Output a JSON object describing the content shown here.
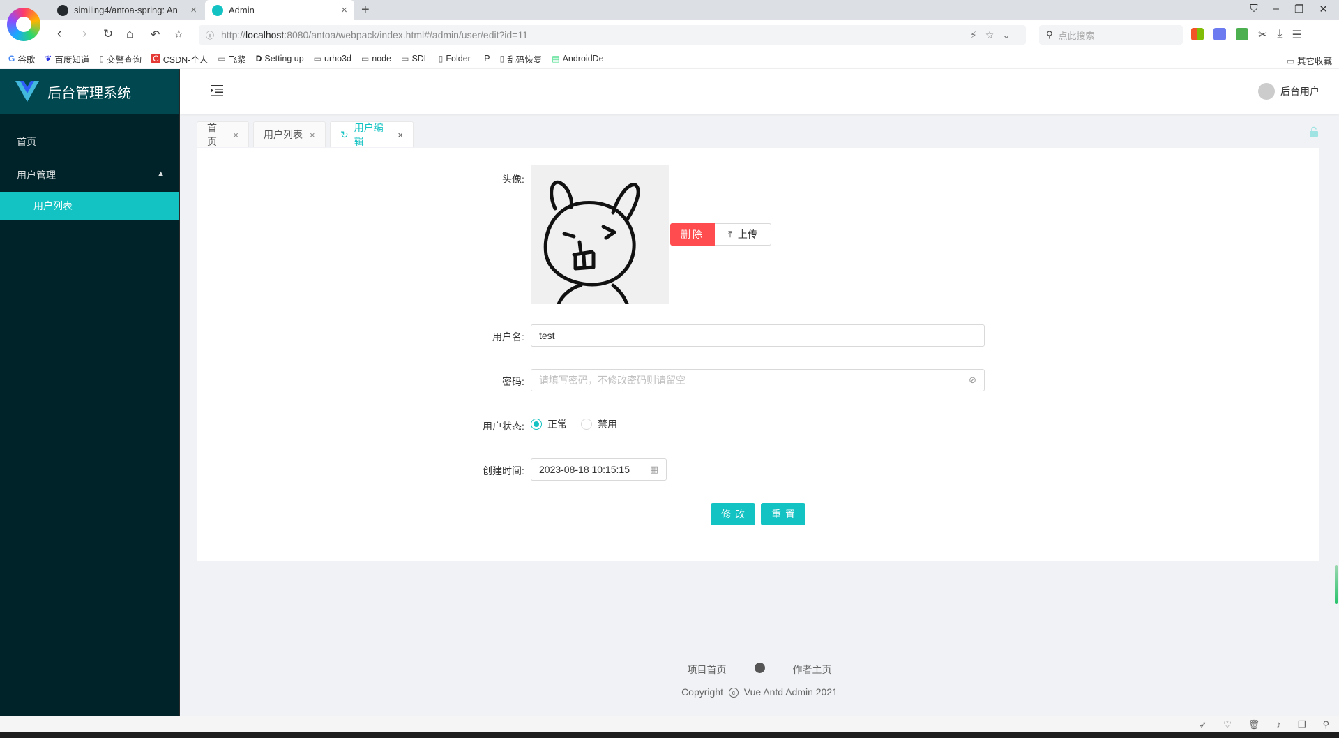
{
  "browser": {
    "tabs": [
      {
        "title": "similing4/antoa-spring: An",
        "close": "×"
      },
      {
        "title": "Admin",
        "close": "×"
      }
    ],
    "new_tab": "+",
    "url_prefix": "http://",
    "url_host": "localhost",
    "url_rest": ":8080/antoa/webpack/index.html#/admin/user/edit?id=11",
    "search_placeholder": "点此搜索",
    "bookmarks": [
      "谷歌",
      "百度知道",
      "交警查询",
      "CSDN-个人",
      "飞浆",
      "Setting up",
      "urho3d",
      "node",
      "SDL",
      "Folder — P",
      "乱码恢复",
      "AndroidDe"
    ],
    "bookmarks_right": "其它收藏"
  },
  "app": {
    "title": "后台管理系统",
    "brand_color": "#13c2c2",
    "sider": {
      "items": [
        {
          "label": "首页"
        },
        {
          "label": "用户管理",
          "expanded": true
        }
      ],
      "sub_items": [
        {
          "label": "用户列表",
          "selected": true
        }
      ]
    },
    "header": {
      "user_name": "后台用户"
    },
    "page_tabs": [
      {
        "label": "首页",
        "close": "×"
      },
      {
        "label": "用户列表",
        "close": "×"
      },
      {
        "label": "用户编辑",
        "close": "×",
        "active": true
      }
    ]
  },
  "form": {
    "avatar_label": "头像:",
    "delete_button": "删除",
    "upload_button": "上传",
    "username_label": "用户名:",
    "username_value": "test",
    "password_label": "密码:",
    "password_placeholder": "请填写密码，不修改密码则请留空",
    "status_label": "用户状态:",
    "status_options": [
      {
        "label": "正常",
        "checked": true
      },
      {
        "label": "禁用",
        "checked": false
      }
    ],
    "created_label": "创建时间:",
    "created_value": "2023-08-18 10:15:15",
    "submit_button": "修改",
    "reset_button": "重置"
  },
  "footer": {
    "link_home": "项目首页",
    "link_author": "作者主页",
    "copyright_prefix": "Copyright",
    "copyright_c": "c",
    "copyright_text": "Vue Antd Admin 2021"
  }
}
